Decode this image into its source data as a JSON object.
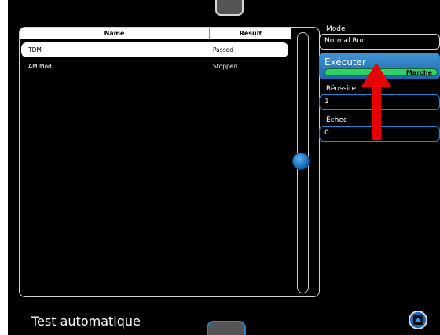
{
  "table": {
    "columns": [
      "Name",
      "Result"
    ],
    "rows": [
      {
        "name": "TDM",
        "result": "Passed"
      },
      {
        "name": "AM Mod",
        "result": "Stopped"
      }
    ]
  },
  "panel": {
    "mode_label": "Mode",
    "mode_value": "Normal Run",
    "run_label": "Exécuter",
    "run_state": "Marche",
    "success_label": "Réussite",
    "success_value": "1",
    "failure_label": "Échec",
    "failure_value": "0"
  },
  "footer": {
    "title": "Test automatique"
  },
  "icons": {
    "nav": "collapse-up-icon"
  },
  "colors": {
    "background": "#000000",
    "accent": "#2b86c8",
    "run_bar": "#2fd16a",
    "annotation_arrow": "#e80000"
  }
}
